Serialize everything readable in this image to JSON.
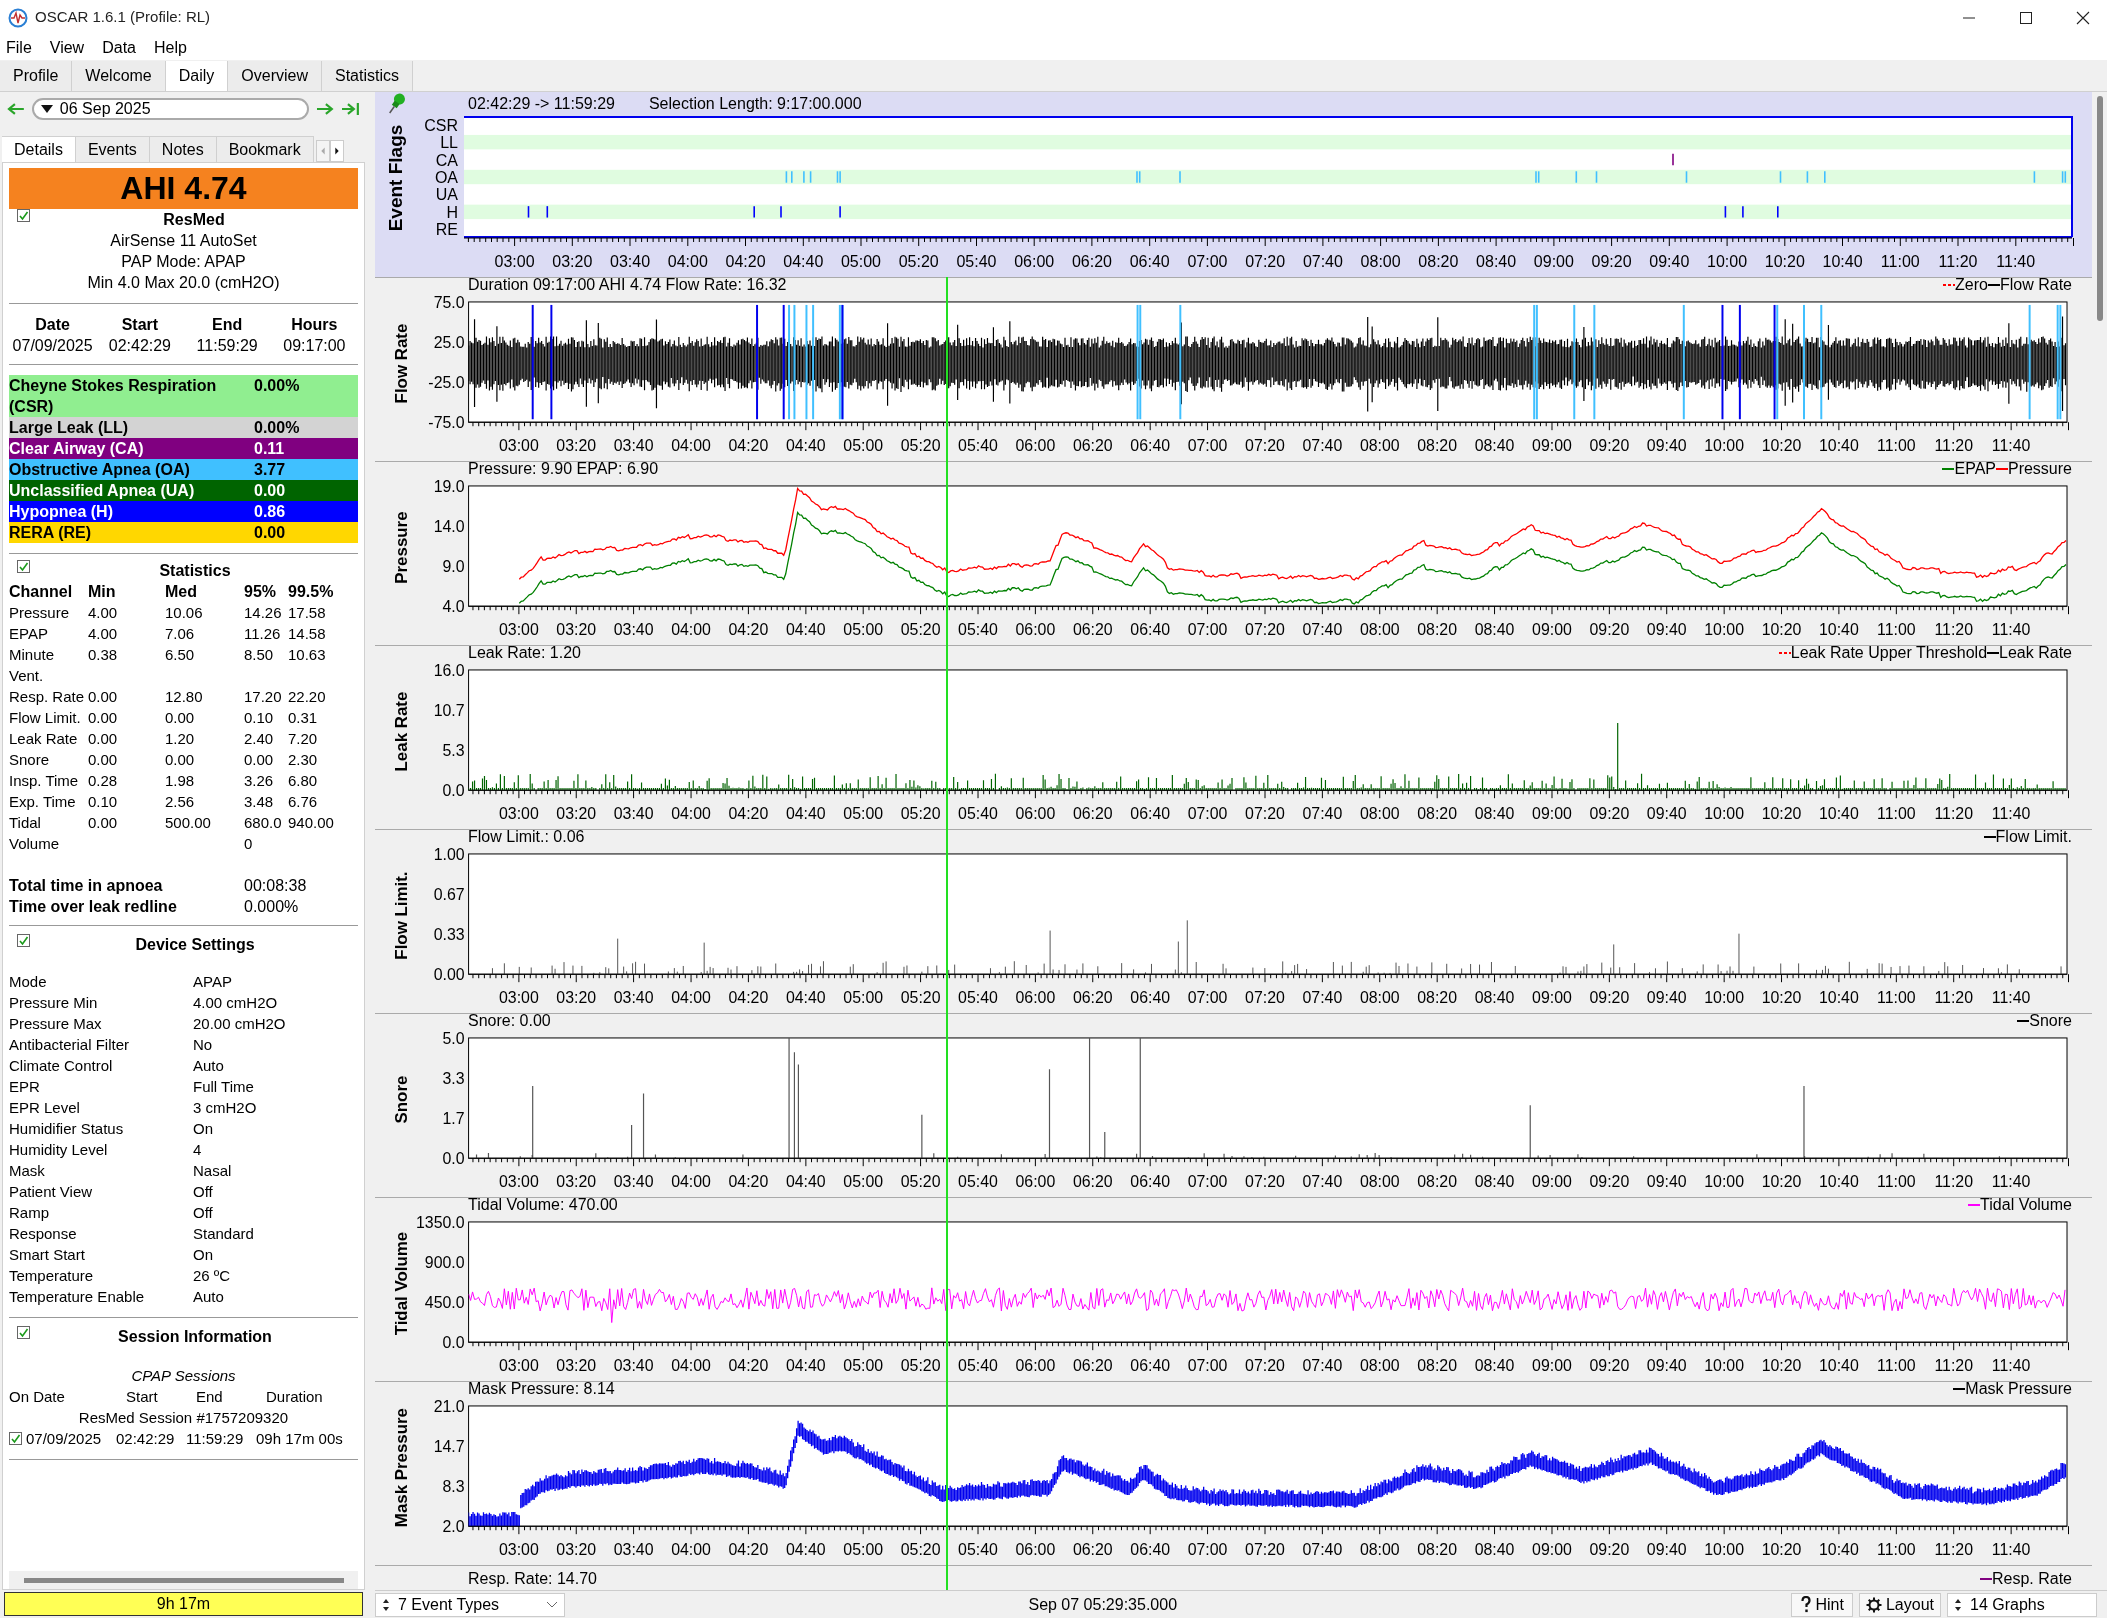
{
  "window": {
    "title": "OSCAR 1.6.1 (Profile: RL)"
  },
  "menu": [
    "File",
    "View",
    "Data",
    "Help"
  ],
  "tabs": [
    {
      "label": "Profile",
      "selected": false
    },
    {
      "label": "Welcome",
      "selected": false
    },
    {
      "label": "Daily",
      "selected": true
    },
    {
      "label": "Overview",
      "selected": false
    },
    {
      "label": "Statistics",
      "selected": false
    }
  ],
  "date_picker": {
    "value": "06 Sep 2025"
  },
  "detail_tabs": [
    {
      "label": "Details",
      "selected": true
    },
    {
      "label": "Events",
      "selected": false
    },
    {
      "label": "Notes",
      "selected": false
    },
    {
      "label": "Bookmark",
      "selected": false
    }
  ],
  "ahi": "AHI 4.74",
  "machine": {
    "checked": true,
    "brand": "ResMed",
    "lines": [
      "AirSense 11 AutoSet",
      "PAP Mode: APAP",
      "Min 4.0 Max 20.0 (cmH2O)"
    ]
  },
  "day_summary": {
    "columns": [
      "Date",
      "Start",
      "End",
      "Hours"
    ],
    "values": [
      "07/09/2025",
      "02:42:29",
      "11:59:29",
      "09:17:00"
    ]
  },
  "event_rates": [
    {
      "label": "Cheyne Stokes Respiration (CSR)",
      "value": "0.00%",
      "color": "#90ee90"
    },
    {
      "label": "Large Leak (LL)",
      "value": "0.00%",
      "color": "#d3d3d3"
    },
    {
      "label": "Clear Airway (CA)",
      "value": "0.11",
      "color": "#800080"
    },
    {
      "label": "Obstructive Apnea (OA)",
      "value": "3.77",
      "color": "#40c0ff"
    },
    {
      "label": "Unclassified Apnea (UA)",
      "value": "0.00",
      "color": "#006400"
    },
    {
      "label": "Hypopnea (H)",
      "value": "0.86",
      "color": "#0000ff"
    },
    {
      "label": "RERA (RE)",
      "value": "0.00",
      "color": "#ffd700"
    }
  ],
  "statistics": {
    "checked": true,
    "title": "Statistics",
    "columns": [
      "Channel",
      "Min",
      "Med",
      "95%",
      "99.5%"
    ],
    "rows": [
      [
        "Pressure",
        "4.00",
        "10.06",
        "14.26",
        "17.58"
      ],
      [
        "EPAP",
        "4.00",
        "7.06",
        "11.26",
        "14.58"
      ],
      [
        "Minute Vent.",
        "0.38",
        "6.50",
        "8.50",
        "10.63"
      ],
      [
        "Resp. Rate",
        "0.00",
        "12.80",
        "17.20",
        "22.20"
      ],
      [
        "Flow Limit.",
        "0.00",
        "0.00",
        "0.10",
        "0.31"
      ],
      [
        "Leak Rate",
        "0.00",
        "1.20",
        "2.40",
        "7.20"
      ],
      [
        "Snore",
        "0.00",
        "0.00",
        "0.00",
        "2.30"
      ],
      [
        "Insp. Time",
        "0.28",
        "1.98",
        "3.26",
        "6.80"
      ],
      [
        "Exp. Time",
        "0.10",
        "2.56",
        "3.48",
        "6.76"
      ],
      [
        "Tidal Volume",
        "0.00",
        "500.00",
        "680.00",
        "940.00"
      ]
    ]
  },
  "totals": [
    {
      "label": "Total time in apnoea",
      "value": "00:08:38"
    },
    {
      "label": "Time over leak redline",
      "value": "0.000%"
    }
  ],
  "device_settings": {
    "checked": true,
    "title": "Device Settings",
    "rows": [
      {
        "label": "Mode",
        "value": "APAP"
      },
      {
        "label": "Pressure Min",
        "value": "4.00 cmH2O"
      },
      {
        "label": "Pressure Max",
        "value": "20.00 cmH2O"
      },
      {
        "label": "Antibacterial Filter",
        "value": "No"
      },
      {
        "label": "Climate Control",
        "value": "Auto"
      },
      {
        "label": "EPR",
        "value": "Full Time"
      },
      {
        "label": "EPR Level",
        "value": "3 cmH2O"
      },
      {
        "label": "Humidifier Status",
        "value": "On"
      },
      {
        "label": "Humidity Level",
        "value": "4"
      },
      {
        "label": "Mask",
        "value": "Nasal"
      },
      {
        "label": "Patient View",
        "value": "Off"
      },
      {
        "label": "Ramp",
        "value": "Off"
      },
      {
        "label": "Response",
        "value": "Standard"
      },
      {
        "label": "Smart Start",
        "value": "On"
      },
      {
        "label": "Temperature",
        "value": "26 ºC"
      },
      {
        "label": "Temperature Enable",
        "value": "Auto"
      }
    ]
  },
  "session_info": {
    "checked": true,
    "title": "Session Information",
    "subtitle": "CPAP Sessions",
    "columns": [
      "On Date",
      "Start",
      "End",
      "Duration"
    ],
    "session_name": "ResMed Session #1757209320",
    "sessions": [
      {
        "checked": true,
        "date": "07/09/2025",
        "start": "02:42:29",
        "end": "11:59:29",
        "duration": "09h 17m 00s"
      }
    ]
  },
  "usage_bar": "9h 17m",
  "event_flags": {
    "title": "Event Flags",
    "range": "02:42:29 -> 11:59:29",
    "selection": "Selection Length: 9:17:00.000",
    "rows": [
      "CSR",
      "LL",
      "CA",
      "OA",
      "UA",
      "H",
      "RE"
    ],
    "x_ticks": [
      "03:00",
      "03:20",
      "03:40",
      "04:00",
      "04:20",
      "04:40",
      "05:00",
      "05:20",
      "05:40",
      "06:00",
      "06:20",
      "06:40",
      "07:00",
      "07:20",
      "07:40",
      "08:00",
      "08:20",
      "08:40",
      "09:00",
      "09:20",
      "09:40",
      "10:00",
      "10:20",
      "10:40",
      "11:00",
      "11:20",
      "11:40"
    ]
  },
  "graphs": [
    {
      "kind": "flow",
      "label": "Flow Rate",
      "title": "Duration 09:17:00 AHI 4.74 Flow Rate: 16.32",
      "legend": [
        {
          "label": "Zero",
          "color": "#ff0000",
          "kind": "reference"
        },
        {
          "label": "Flow Rate",
          "color": "#000000",
          "kind": "series"
        }
      ],
      "y_ticks": [
        "75.0",
        "25.0",
        "-25.0",
        "-75.0"
      ],
      "x_ticks": [
        "03:00",
        "03:20",
        "03:40",
        "04:00",
        "04:20",
        "04:40",
        "05:00",
        "05:20",
        "05:40",
        "06:00",
        "06:20",
        "06:40",
        "07:00",
        "07:20",
        "07:40",
        "08:00",
        "08:20",
        "08:40",
        "09:00",
        "09:20",
        "09:40",
        "10:00",
        "10:20",
        "10:40",
        "11:00",
        "11:20",
        "11:40"
      ]
    },
    {
      "kind": "pressure",
      "label": "Pressure",
      "title": "Pressure: 9.90 EPAP: 6.90",
      "legend": [
        {
          "label": "EPAP",
          "color": "#008000",
          "kind": "series"
        },
        {
          "label": "Pressure",
          "color": "#ff0000",
          "kind": "series"
        }
      ],
      "y_ticks": [
        "19.0",
        "14.0",
        "9.0",
        "4.0"
      ],
      "x_ticks": [
        "03:00",
        "03:20",
        "03:40",
        "04:00",
        "04:20",
        "04:40",
        "05:00",
        "05:20",
        "05:40",
        "06:00",
        "06:20",
        "06:40",
        "07:00",
        "07:20",
        "07:40",
        "08:00",
        "08:20",
        "08:40",
        "09:00",
        "09:20",
        "09:40",
        "10:00",
        "10:20",
        "10:40",
        "11:00",
        "11:20",
        "11:40"
      ]
    },
    {
      "kind": "leak",
      "label": "Leak Rate",
      "title": "Leak Rate: 1.20",
      "legend": [
        {
          "label": "Leak Rate Upper Threshold",
          "color": "#ff0000",
          "kind": "reference"
        },
        {
          "label": "Leak Rate",
          "color": "#000000",
          "kind": "series"
        }
      ],
      "y_ticks": [
        "16.0",
        "10.7",
        "5.3",
        "0.0"
      ],
      "x_ticks": [
        "03:00",
        "03:20",
        "03:40",
        "04:00",
        "04:20",
        "04:40",
        "05:00",
        "05:20",
        "05:40",
        "06:00",
        "06:20",
        "06:40",
        "07:00",
        "07:20",
        "07:40",
        "08:00",
        "08:20",
        "08:40",
        "09:00",
        "09:20",
        "09:40",
        "10:00",
        "10:20",
        "10:40",
        "11:00",
        "11:20",
        "11:40"
      ]
    },
    {
      "kind": "flow_limit",
      "label": "Flow Limit.",
      "title": "Flow Limit.: 0.06",
      "legend": [
        {
          "label": "Flow Limit.",
          "color": "#000000",
          "kind": "series"
        }
      ],
      "y_ticks": [
        "1.00",
        "0.67",
        "0.33",
        "0.00"
      ],
      "x_ticks": [
        "03:00",
        "03:20",
        "03:40",
        "04:00",
        "04:20",
        "04:40",
        "05:00",
        "05:20",
        "05:40",
        "06:00",
        "06:20",
        "06:40",
        "07:00",
        "07:20",
        "07:40",
        "08:00",
        "08:20",
        "08:40",
        "09:00",
        "09:20",
        "09:40",
        "10:00",
        "10:20",
        "10:40",
        "11:00",
        "11:20",
        "11:40"
      ]
    },
    {
      "kind": "snore",
      "label": "Snore",
      "title": "Snore: 0.00",
      "legend": [
        {
          "label": "Snore",
          "color": "#000000",
          "kind": "series"
        }
      ],
      "y_ticks": [
        "5.0",
        "3.3",
        "1.7",
        "0.0"
      ],
      "x_ticks": [
        "03:00",
        "03:20",
        "03:40",
        "04:00",
        "04:20",
        "04:40",
        "05:00",
        "05:20",
        "05:40",
        "06:00",
        "06:20",
        "06:40",
        "07:00",
        "07:20",
        "07:40",
        "08:00",
        "08:20",
        "08:40",
        "09:00",
        "09:20",
        "09:40",
        "10:00",
        "10:20",
        "10:40",
        "11:00",
        "11:20",
        "11:40"
      ]
    },
    {
      "kind": "tidal",
      "label": "Tidal Volume",
      "title": "Tidal Volume: 470.00",
      "legend": [
        {
          "label": "Tidal Volume",
          "color": "#ff00ff",
          "kind": "series"
        }
      ],
      "y_ticks": [
        "1350.0",
        "900.0",
        "450.0",
        "0.0"
      ],
      "x_ticks": [
        "03:00",
        "03:20",
        "03:40",
        "04:00",
        "04:20",
        "04:40",
        "05:00",
        "05:20",
        "05:40",
        "06:00",
        "06:20",
        "06:40",
        "07:00",
        "07:20",
        "07:40",
        "08:00",
        "08:20",
        "08:40",
        "09:00",
        "09:20",
        "09:40",
        "10:00",
        "10:20",
        "10:40",
        "11:00",
        "11:20",
        "11:40"
      ]
    },
    {
      "kind": "mask",
      "label": "Mask Pressure",
      "title": "Mask Pressure: 8.14",
      "legend": [
        {
          "label": "Mask Pressure",
          "color": "#000000",
          "kind": "series"
        }
      ],
      "y_ticks": [
        "21.0",
        "14.7",
        "8.3",
        "2.0"
      ],
      "x_ticks": [
        "03:00",
        "03:20",
        "03:40",
        "04:00",
        "04:20",
        "04:40",
        "05:00",
        "05:20",
        "05:40",
        "06:00",
        "06:20",
        "06:40",
        "07:00",
        "07:20",
        "07:40",
        "08:00",
        "08:20",
        "08:40",
        "09:00",
        "09:20",
        "09:40",
        "10:00",
        "10:20",
        "10:40",
        "11:00",
        "11:20",
        "11:40"
      ]
    },
    {
      "kind": "resp",
      "title": "Resp. Rate: 14.70",
      "legend": [
        {
          "label": "Resp. Rate",
          "color": "#800080",
          "kind": "series"
        }
      ]
    }
  ],
  "status_bar": {
    "event_types": "7 Event Types",
    "cursor_time": "Sep 07 05:29:35.000",
    "hint": "Hint",
    "layout": "Layout",
    "graphs": "14 Graphs"
  }
}
